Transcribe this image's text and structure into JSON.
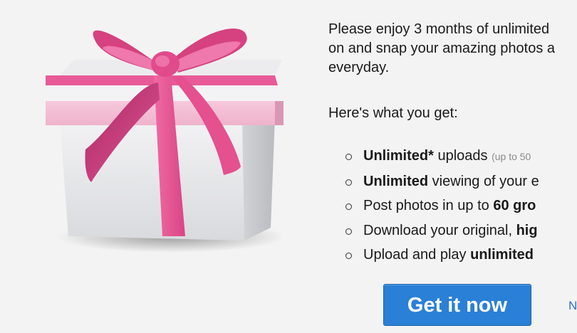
{
  "offer": {
    "intro_lines": [
      "Please enjoy 3 months of unlimited",
      "on and snap your amazing photos a",
      "everyday."
    ],
    "whats_included": "Here's what you get:",
    "features": [
      {
        "bold": "Unlimited*",
        "text": " uploads ",
        "small": "(up to 50"
      },
      {
        "bold": "Unlimited",
        "text": " viewing of your e"
      },
      {
        "text": "Post photos in up to ",
        "bold": "60 gro"
      },
      {
        "text": "Download your original, ",
        "bold": "hig"
      },
      {
        "text": "Upload and play ",
        "bold": "unlimited"
      }
    ]
  },
  "cta": {
    "label": "Get it now"
  },
  "secondary_link": {
    "label": "N"
  },
  "colors": {
    "cta": "#2a80d6",
    "ribbon": "#e0528f",
    "link": "#2a6fc1"
  },
  "icons": {
    "hero": "gift-box-icon",
    "bullet": "hollow-circle-bullet-icon"
  }
}
